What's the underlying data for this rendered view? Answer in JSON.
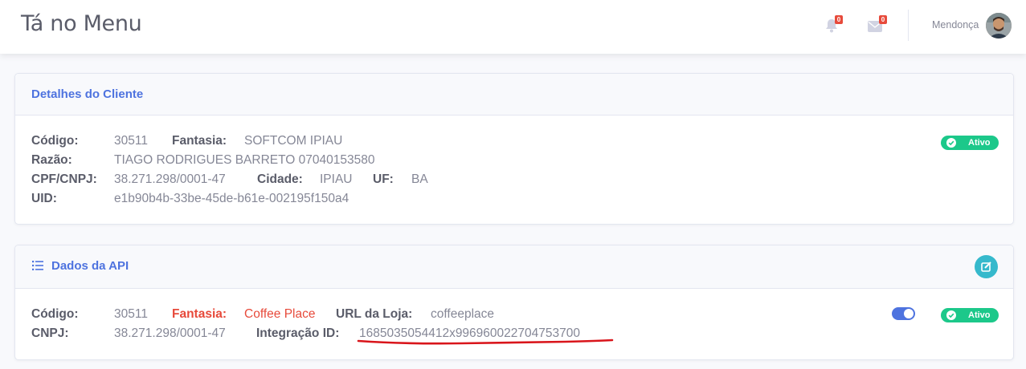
{
  "app": {
    "title": "Tá no Menu"
  },
  "topbar": {
    "alerts_count": "0",
    "messages_count": "0",
    "user_name": "Mendonça"
  },
  "client_card": {
    "title": "Detalhes do Cliente",
    "status": "Ativo",
    "codigo_label": "Código:",
    "codigo": "30511",
    "fantasia_label": "Fantasia:",
    "fantasia": "SOFTCOM IPIAU",
    "razao_label": "Razão:",
    "razao": "TIAGO RODRIGUES BARRETO 07040153580",
    "cpf_label": "CPF/CNPJ:",
    "cpf": "38.271.298/0001-47",
    "cidade_label": "Cidade:",
    "cidade": "IPIAU",
    "uf_label": "UF:",
    "uf": "BA",
    "uid_label": "UID:",
    "uid": "e1b90b4b-33be-45de-b61e-002195f150a4"
  },
  "api_card": {
    "title": "Dados da API",
    "status": "Ativo",
    "toggle_on": true,
    "codigo_label": "Código:",
    "codigo": "30511",
    "fantasia_label": "Fantasia:",
    "fantasia": "Coffee Place",
    "url_label": "URL da Loja:",
    "url": "coffeeplace",
    "cnpj_label": "CNPJ:",
    "cnpj": "38.271.298/0001-47",
    "integracao_label": "Integração ID:",
    "integracao": "1685035054412x996960022704753700"
  },
  "colors": {
    "primary": "#4e73df",
    "success": "#1cc88a",
    "danger": "#e74a3b",
    "info": "#36b9cc",
    "annotation": "#d9151b"
  }
}
